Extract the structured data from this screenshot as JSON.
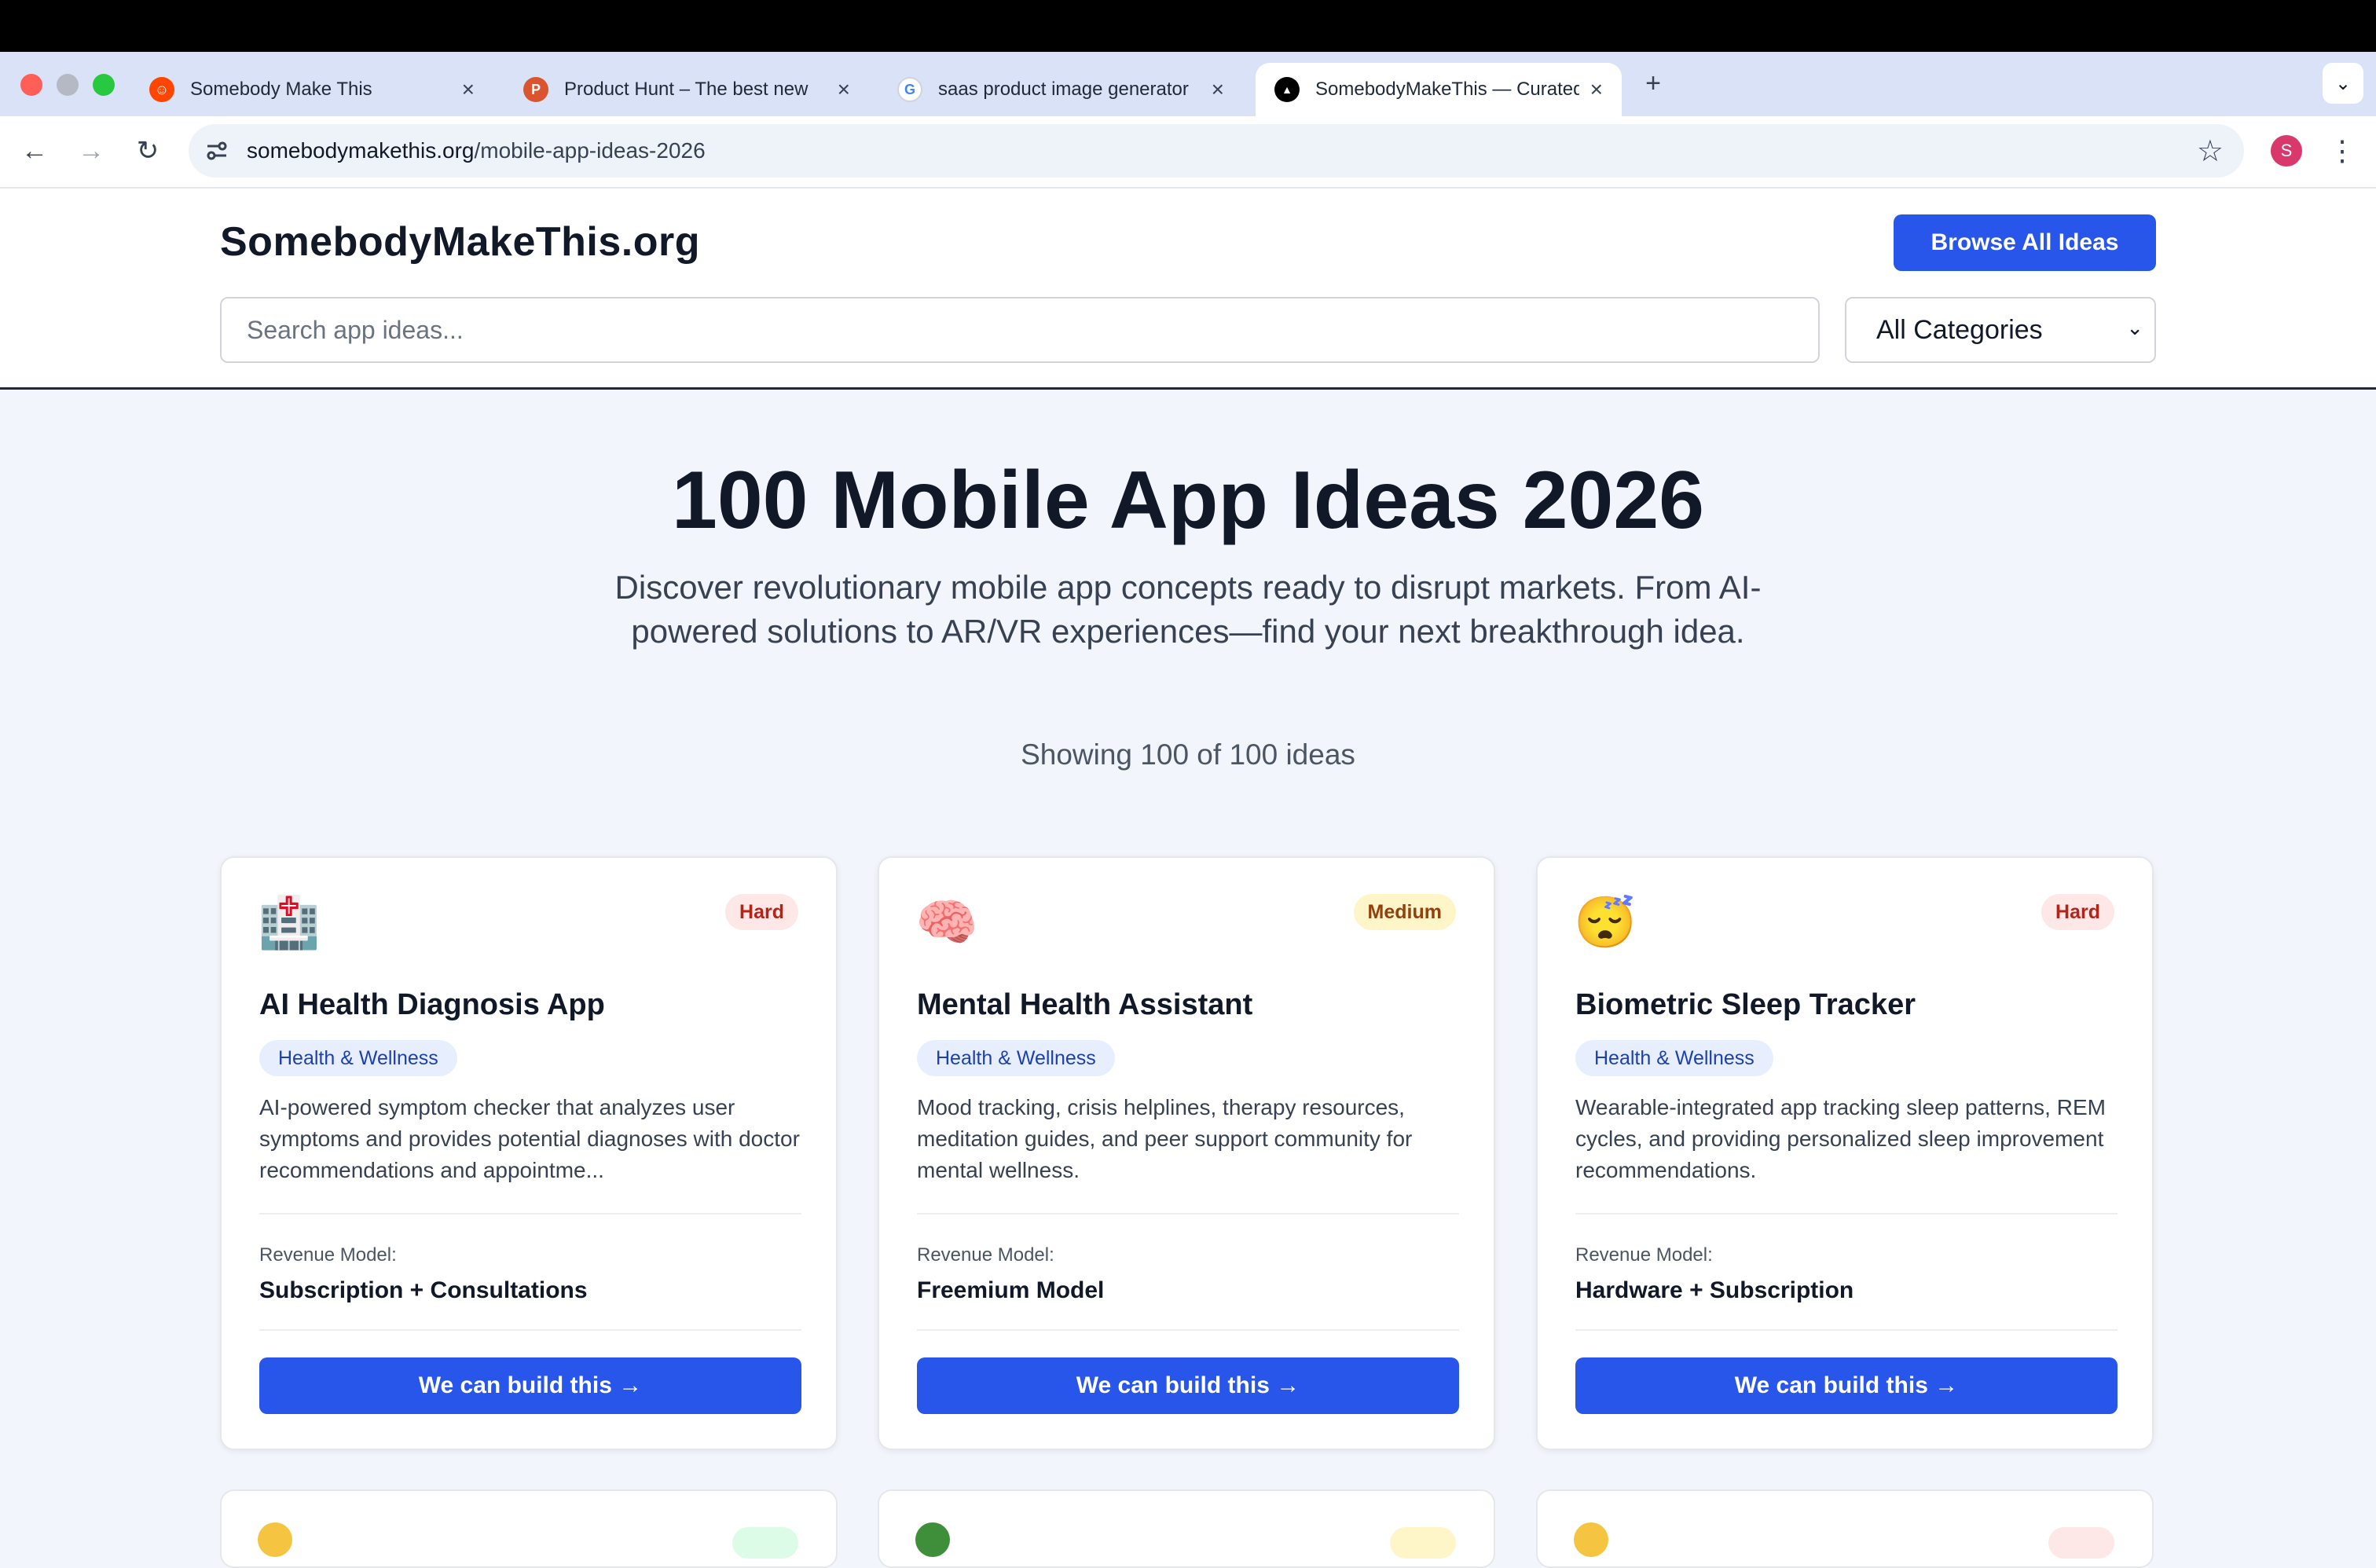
{
  "browser": {
    "tabs": [
      {
        "title": "Somebody Make This",
        "favicon": "reddit-alien-icon",
        "active": false
      },
      {
        "title": "Product Hunt – The best new",
        "favicon": "product-hunt-icon",
        "active": false
      },
      {
        "title": "saas product image generator",
        "favicon": "google-icon",
        "active": false
      },
      {
        "title": "SomebodyMakeThis — Curated",
        "favicon": "triangle-logo-icon",
        "active": true
      }
    ],
    "url_domain": "somebodymakethis.org",
    "url_path": "/mobile-app-ideas-2026",
    "profile_initial": "S"
  },
  "site": {
    "logo": "SomebodyMakeThis.org",
    "browse_label": "Browse All Ideas",
    "search_placeholder": "Search app ideas...",
    "category_selected": "All Categories"
  },
  "hero": {
    "title": "100 Mobile App Ideas 2026",
    "subtitle": "Discover revolutionary mobile app concepts ready to disrupt markets. From AI-powered solutions to AR/VR experiences—find your next breakthrough idea.",
    "showing": "Showing 100 of 100 ideas"
  },
  "cards": [
    {
      "icon": "🏥",
      "difficulty": "Hard",
      "title": "AI Health Diagnosis App",
      "category": "Health & Wellness",
      "description": "AI-powered symptom checker that analyzes user symptoms and provides potential diagnoses with doctor recommendations and appointme...",
      "revenue_label": "Revenue Model:",
      "revenue_model": "Subscription + Consultations",
      "cta": "We can build this →"
    },
    {
      "icon": "🧠",
      "difficulty": "Medium",
      "title": "Mental Health Assistant",
      "category": "Health & Wellness",
      "description": "Mood tracking, crisis helplines, therapy resources, meditation guides, and peer support community for mental wellness.",
      "revenue_label": "Revenue Model:",
      "revenue_model": "Freemium Model",
      "cta": "We can build this →"
    },
    {
      "icon": "😴",
      "difficulty": "Hard",
      "title": "Biometric Sleep Tracker",
      "category": "Health & Wellness",
      "description": "Wearable-integrated app tracking sleep patterns, REM cycles, and providing personalized sleep improvement recommendations.",
      "revenue_label": "Revenue Model:",
      "revenue_model": "Hardware + Subscription",
      "cta": "We can build this →"
    }
  ],
  "colors": {
    "primary": "#2856ea",
    "page_bg": "#f2f5fb",
    "hard_badge_bg": "#fde7e7",
    "medium_badge_bg": "#fef6c8",
    "easy_badge_bg": "#dcfce7",
    "tag_bg": "#e7efff"
  }
}
